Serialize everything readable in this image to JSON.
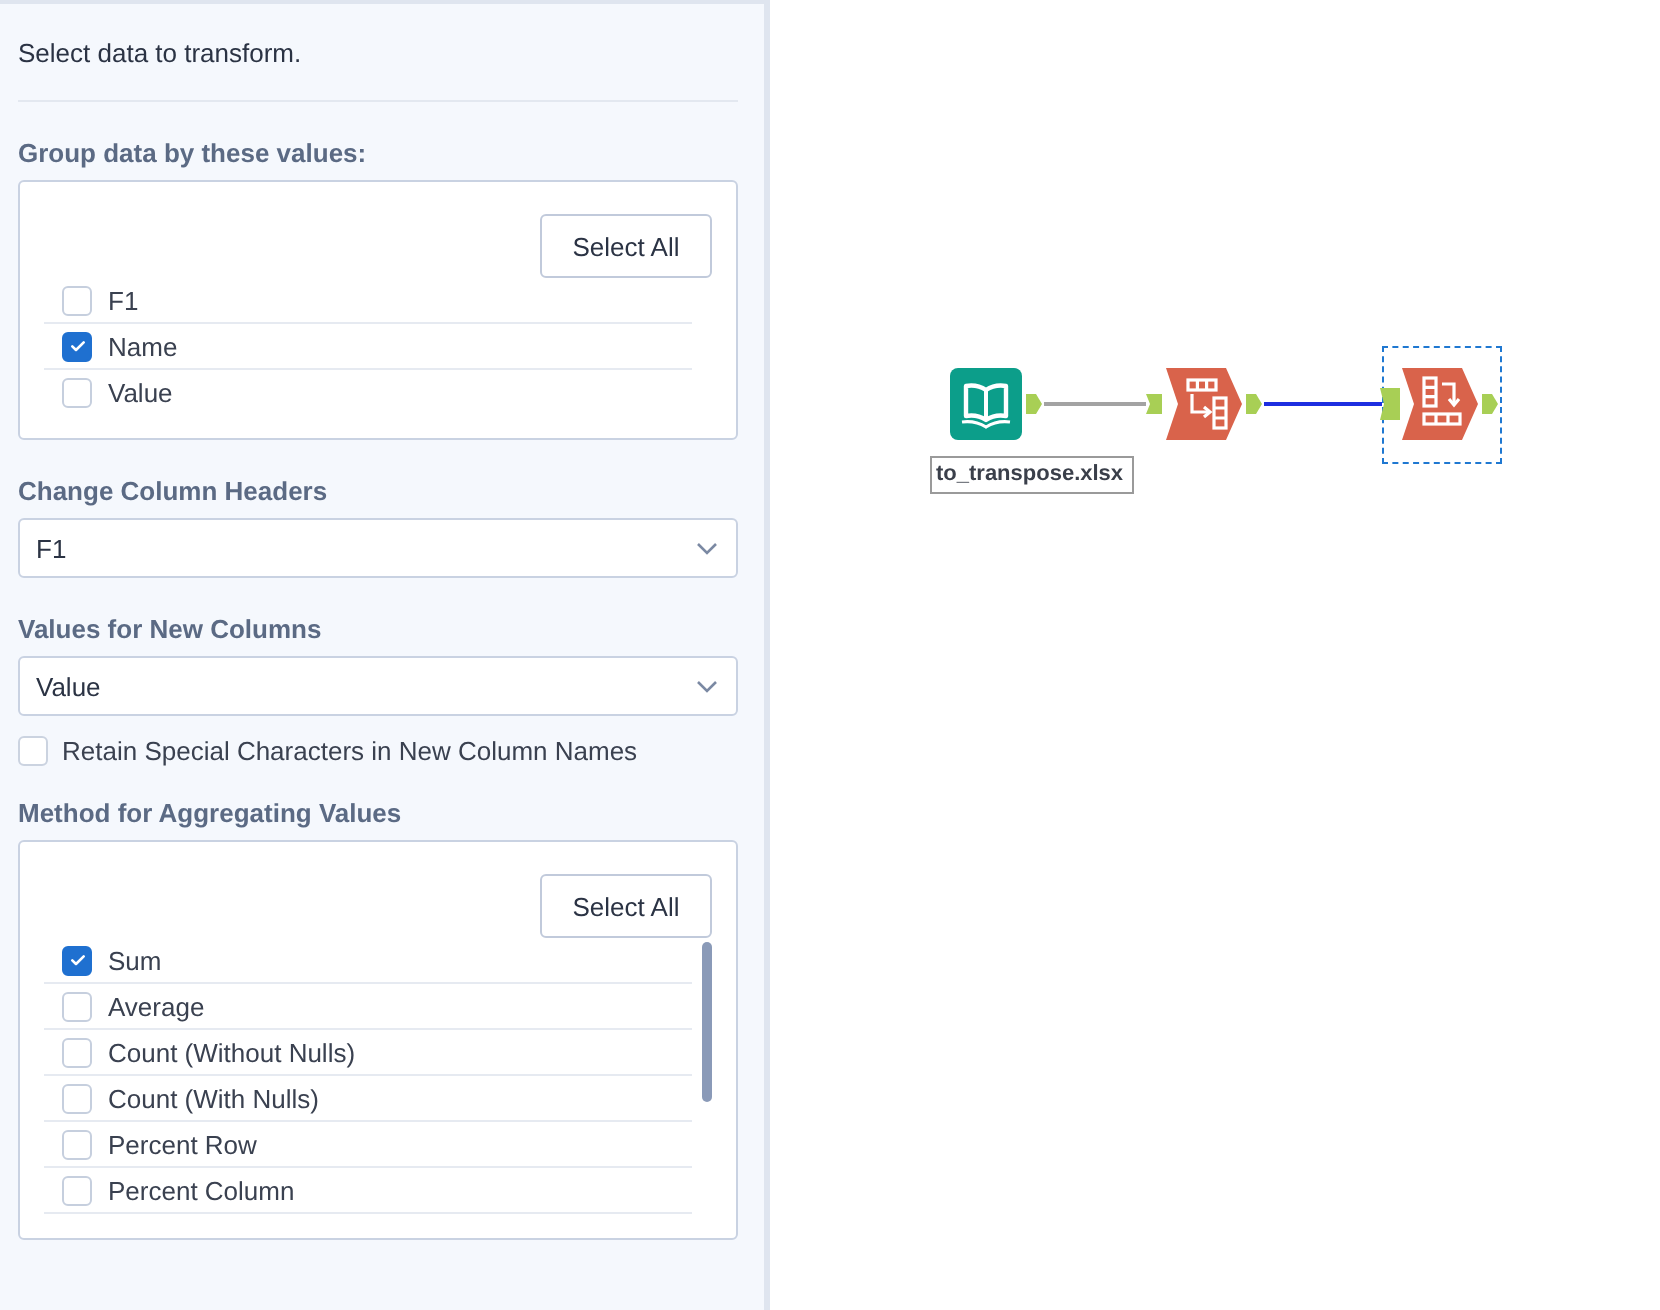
{
  "panel": {
    "intro": "Select data to transform.",
    "group_by": {
      "label": "Group data by these values:",
      "button": "Select All",
      "items": [
        {
          "label": "F1",
          "checked": false
        },
        {
          "label": "Name",
          "checked": true
        },
        {
          "label": "Value",
          "checked": false
        }
      ]
    },
    "column_headers": {
      "label": "Change Column Headers",
      "value": "F1"
    },
    "new_column_values": {
      "label": "Values for New Columns",
      "value": "Value"
    },
    "retain_special": {
      "label": "Retain Special Characters in New Column Names",
      "checked": false
    },
    "aggregation": {
      "label": "Method for Aggregating Values",
      "button": "Select All",
      "items": [
        {
          "label": "Sum",
          "checked": true
        },
        {
          "label": "Average",
          "checked": false
        },
        {
          "label": "Count (Without Nulls)",
          "checked": false
        },
        {
          "label": "Count (With Nulls)",
          "checked": false
        },
        {
          "label": "Percent Row",
          "checked": false
        },
        {
          "label": "Percent Column",
          "checked": false
        }
      ]
    }
  },
  "workflow": {
    "nodes": [
      {
        "kind": "input",
        "label": "to_transpose.xlsx",
        "selected": false
      },
      {
        "kind": "transpose",
        "selected": false
      },
      {
        "kind": "crosstab",
        "selected": true
      }
    ],
    "connections": [
      {
        "selected": false
      },
      {
        "selected": true
      }
    ]
  }
}
